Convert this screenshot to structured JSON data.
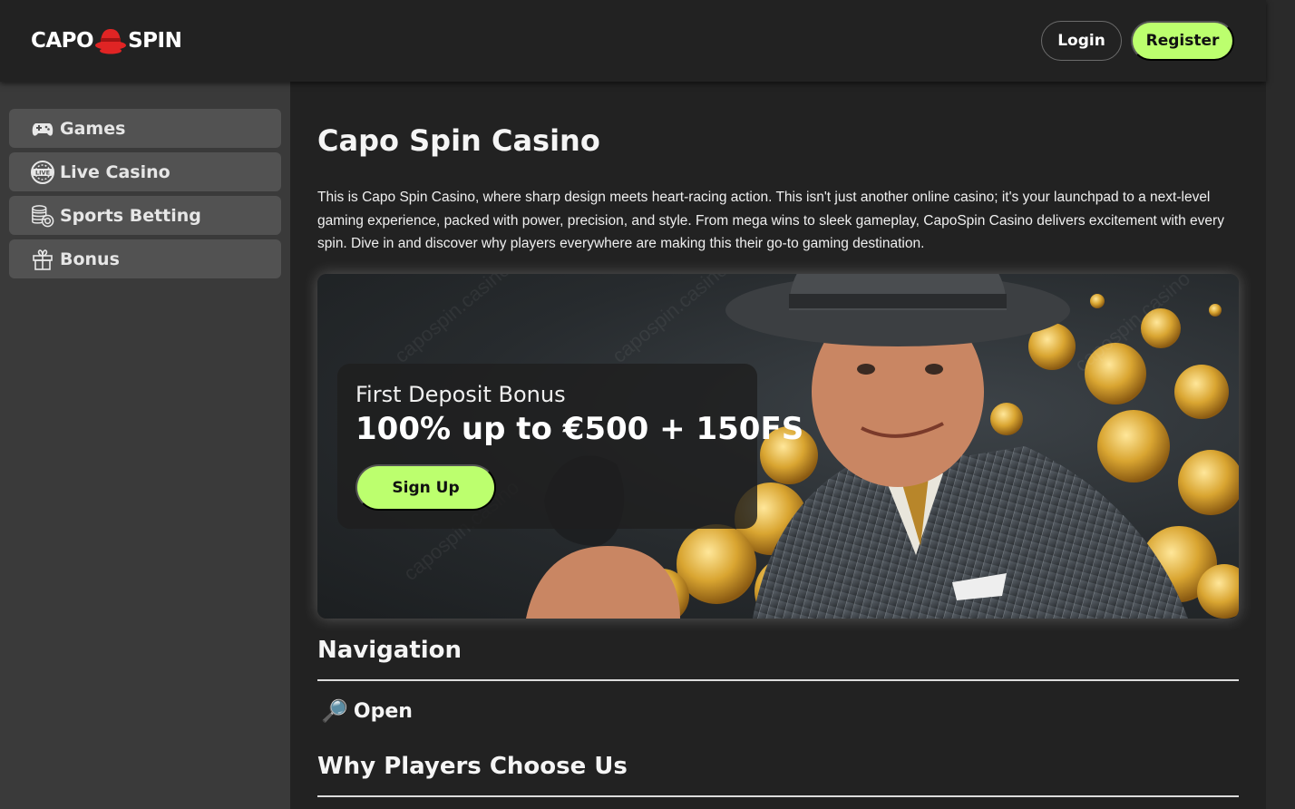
{
  "header": {
    "logo_left": "CAPO",
    "logo_right": "SPIN",
    "login_label": "Login",
    "register_label": "Register"
  },
  "sidebar": {
    "items": [
      {
        "label": "Games",
        "icon": "gamepad-icon"
      },
      {
        "label": "Live Casino",
        "icon": "live-icon"
      },
      {
        "label": "Sports Betting",
        "icon": "coins-stack-icon"
      },
      {
        "label": "Bonus",
        "icon": "gift-icon"
      }
    ]
  },
  "main": {
    "title": "Capo Spin Casino",
    "intro": "This is Capo Spin Casino, where sharp design meets heart-racing action. This isn't just another online casino; it's your launchpad to a next-level gaming experience, packed with power, precision, and style. From mega wins to sleek gameplay, CapoSpin Casino delivers excitement with every spin. Dive in and discover why players everywhere are making this their go-to gaming destination.",
    "banner": {
      "subtitle": "First Deposit Bonus",
      "offer": "100% up to €500 + 150FS",
      "cta_label": "Sign Up",
      "watermark": "capospin.casino"
    },
    "navigation_heading": "Navigation",
    "toc_toggle_icon": "🔎",
    "toc_toggle_label": "Open",
    "why_heading": "Why Players Choose Us"
  },
  "colors": {
    "accent": "#bcff6e",
    "background": "#222222",
    "sidebar": "#3a3a3a",
    "sidebar_item": "#525252",
    "logo_hat": "#e02424"
  }
}
